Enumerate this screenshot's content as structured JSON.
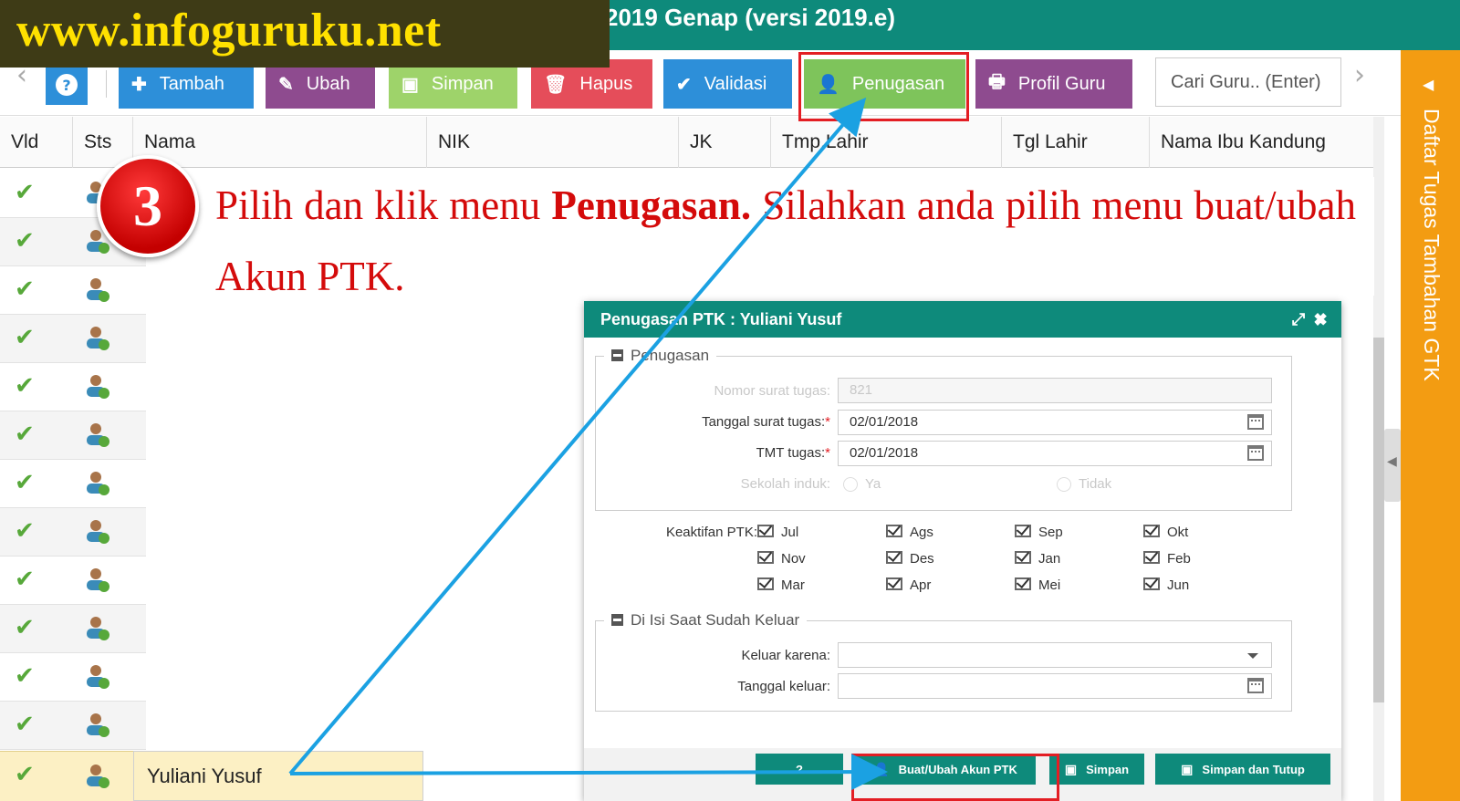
{
  "app": {
    "title": "2019 Genap (versi 2019.e)"
  },
  "watermark": {
    "text": "www.infoguruku.net"
  },
  "toolbar": {
    "help": "?",
    "tambah": "Tambah",
    "ubah": "Ubah",
    "simpan": "Simpan",
    "hapus": "Hapus",
    "validasi": "Validasi",
    "penugasan": "Penugasan",
    "profil_guru": "Profil Guru",
    "search_placeholder": "Cari Guru.. (Enter)",
    "colors": {
      "tambah": "#2d8fd9",
      "ubah": "#8e4b8f",
      "simpan": "#9ed36a",
      "hapus": "#e54d5a",
      "validasi": "#2d8fd9",
      "penugasan": "#7ec45b",
      "profil_guru": "#8e4b8f"
    }
  },
  "table": {
    "columns": [
      "Vld",
      "Sts",
      "Nama",
      "NIK",
      "JK",
      "Tmp.Lahir",
      "Tgl Lahir",
      "Nama Ibu Kandung"
    ],
    "selected_name": "Yuliani Yusuf"
  },
  "annotation": {
    "step": "3",
    "line_a": "Pilih dan klik menu ",
    "line_bold": "Penugasan.",
    "line_b": " Silahkan anda pilih menu buat/ubah Akun PTK."
  },
  "dialog": {
    "title": "Penugasan PTK : Yuliani Yusuf",
    "section_penugasan": "Penugasan",
    "nomor_label": "Nomor surat tugas:",
    "nomor_value": "821",
    "tanggal_label": "Tanggal surat tugas:",
    "tanggal_value": "02/01/2018",
    "tmt_label": "TMT tugas:",
    "tmt_value": "02/01/2018",
    "req": "*",
    "sekolah_label": "Sekolah induk:",
    "ya": "Ya",
    "tidak": "Tidak",
    "keaktifan_label": "Keaktifan PTK:",
    "months": [
      "Jul",
      "Ags",
      "Sep",
      "Okt",
      "Nov",
      "Des",
      "Jan",
      "Feb",
      "Mar",
      "Apr",
      "Mei",
      "Jun"
    ],
    "section_keluar": "Di Isi Saat Sudah Keluar",
    "keluar_label": "Keluar karena:",
    "tgl_keluar_label": "Tanggal keluar:",
    "btn_help": "?",
    "btn_akun": "Buat/Ubah Akun PTK",
    "btn_simpan": "Simpan",
    "btn_simpan_tutup": "Simpan dan Tutup"
  },
  "right_panel": {
    "label": "Daftar Tugas Tambahan GTK"
  }
}
